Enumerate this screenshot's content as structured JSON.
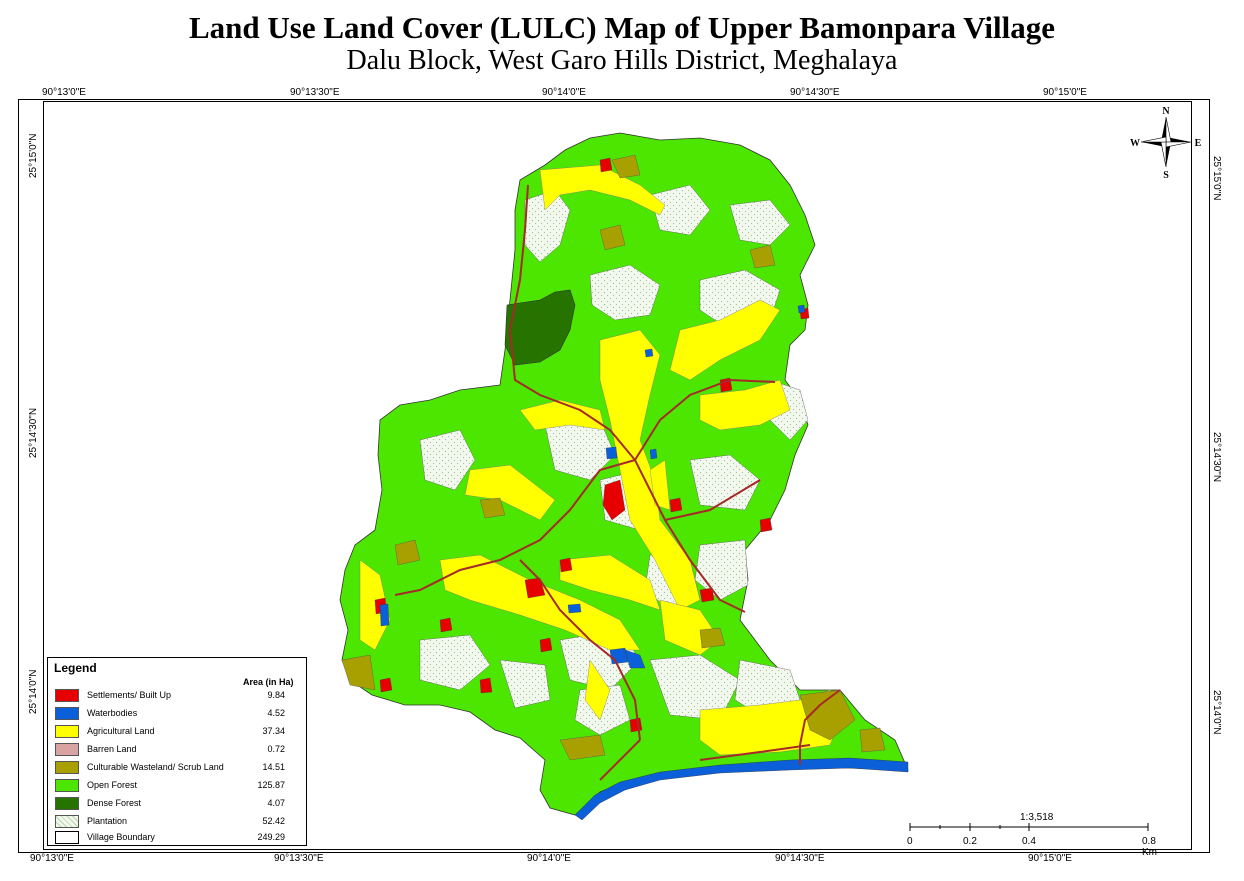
{
  "title": "Land Use Land Cover (LULC) Map of Upper Bamonpara Village",
  "subtitle": "Dalu Block, West Garo Hills District, Meghalaya",
  "grid": {
    "top_labels": [
      "90°13'0\"E",
      "90°13'30\"E",
      "90°14'0\"E",
      "90°14'30\"E",
      "90°15'0\"E"
    ],
    "bottom_labels": [
      "90°13'0\"E",
      "90°13'30\"E",
      "90°14'0\"E",
      "90°14'30\"E",
      "90°15'0\"E"
    ],
    "left_labels": [
      "25°15'0\"N",
      "25°14'30\"N",
      "25°14'0\"N"
    ],
    "right_labels": [
      "25°15'0\"N",
      "25°14'30\"N",
      "25°14'0\"N"
    ]
  },
  "north_arrow": {
    "n": "N",
    "s": "S",
    "e": "E",
    "w": "W",
    "icon": "north-arrow-icon"
  },
  "legend": {
    "title": "Legend",
    "column_header": "Area (in Ha)",
    "items": [
      {
        "label": "Settlements/ Built Up",
        "value": "9.84",
        "color": "#e60000"
      },
      {
        "label": "Waterbodies",
        "value": "4.52",
        "color": "#0b5fd8"
      },
      {
        "label": "Agricultural Land",
        "value": "37.34",
        "color": "#ffff00"
      },
      {
        "label": "Barren Land",
        "value": "0.72",
        "color": "#d7a3a3"
      },
      {
        "label": "Culturable Wasteland/ Scrub Land",
        "value": "14.51",
        "color": "#a8a000"
      },
      {
        "label": "Open Forest",
        "value": "125.87",
        "color": "#4ce600"
      },
      {
        "label": "Dense Forest",
        "value": "4.07",
        "color": "#267300"
      },
      {
        "label": "Plantation",
        "value": "52.42",
        "color": "#f2f8ee"
      },
      {
        "label": "Village Boundary",
        "value": "249.29",
        "color": "#ffffff"
      }
    ]
  },
  "scale": {
    "ratio": "1:3,518",
    "ticks": [
      "0",
      "0.2",
      "0.4",
      "0.8 Km"
    ]
  },
  "colors": {
    "road": "#a52a2a",
    "river": "#0b5fd8"
  }
}
